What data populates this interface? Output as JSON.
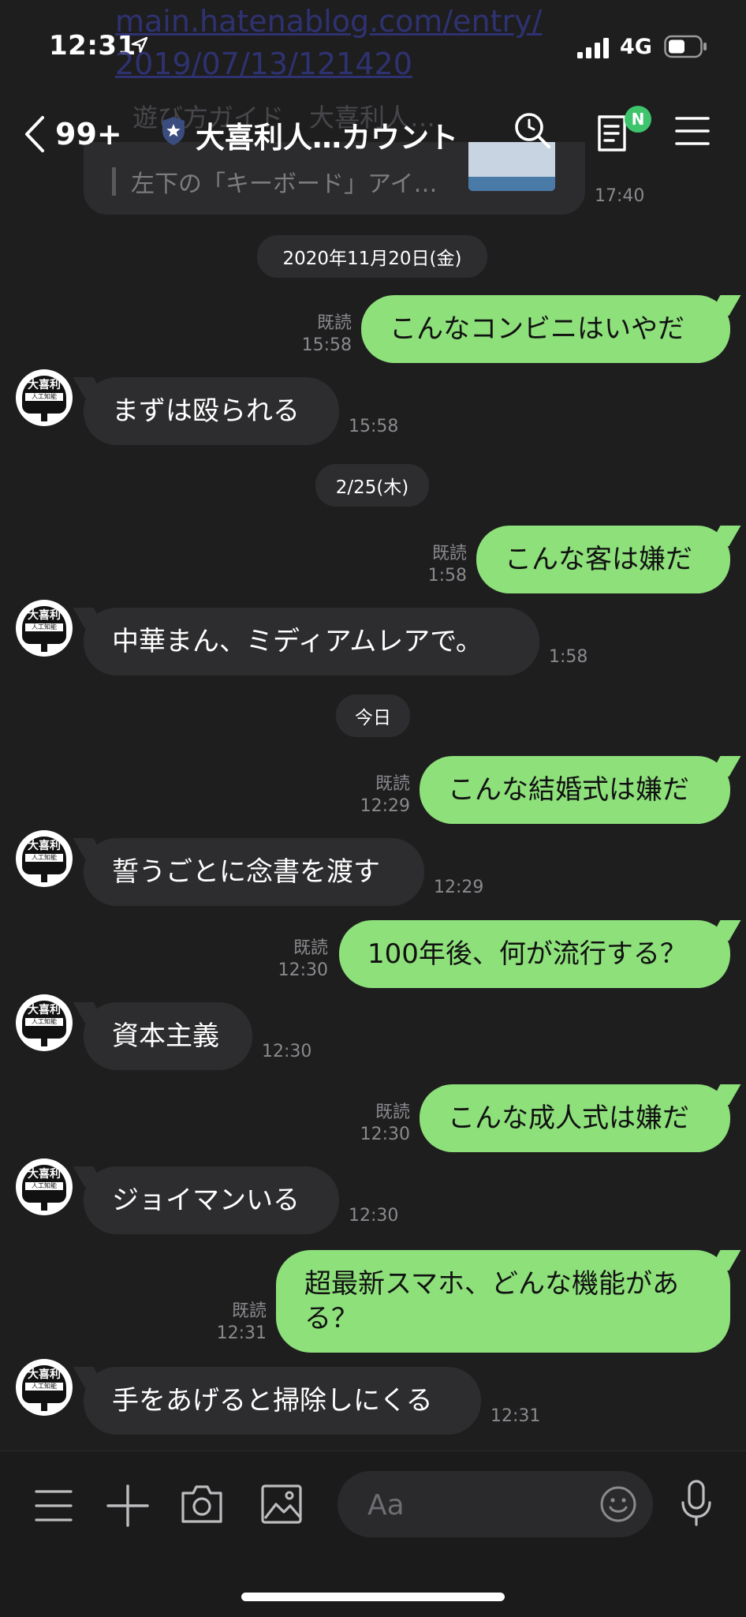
{
  "status_bar": {
    "time": "12:31",
    "network": "4G"
  },
  "background_url": [
    "main.hatenablog.com/entry/",
    "2019/07/13/121420"
  ],
  "header": {
    "back_count": "99+",
    "title": "大喜利人…カウント",
    "badge": "N"
  },
  "previous_preview": {
    "title": "遊び方ガイド　大喜利人…",
    "text": "左下の「キーボード」アイ…",
    "time": "17:40"
  },
  "dates": {
    "d1": "2020年11月20日(金)",
    "d2": "2/25(木)",
    "d3": "今日"
  },
  "messages": [
    {
      "from": "me",
      "text": "こんなコンビニはいやだ",
      "read": "既読",
      "time": "15:58"
    },
    {
      "from": "bot",
      "text": "まずは殴られる",
      "time": "15:58"
    },
    {
      "from": "me",
      "text": "こんな客は嫌だ",
      "read": "既読",
      "time": "1:58"
    },
    {
      "from": "bot",
      "text": "中華まん、ミディアムレアで。",
      "time": "1:58"
    },
    {
      "from": "me",
      "text": "こんな結婚式は嫌だ",
      "read": "既読",
      "time": "12:29"
    },
    {
      "from": "bot",
      "text": "誓うごとに念書を渡す",
      "time": "12:29"
    },
    {
      "from": "me",
      "text": "100年後、何が流行する？",
      "read": "既読",
      "time": "12:30"
    },
    {
      "from": "bot",
      "text": "資本主義",
      "time": "12:30"
    },
    {
      "from": "me",
      "text": "こんな成人式は嫌だ",
      "read": "既読",
      "time": "12:30"
    },
    {
      "from": "bot",
      "text": "ジョイマンいる",
      "time": "12:30"
    },
    {
      "from": "me",
      "text_line1": "超最新スマホ、どんな機能があ",
      "text_line2": "る？",
      "read": "既読",
      "time": "12:31"
    },
    {
      "from": "bot",
      "text": "手をあげると掃除しにくる",
      "time": "12:31"
    }
  ],
  "avatar": {
    "label": "大喜利",
    "sub": "人工知能"
  },
  "input": {
    "placeholder": "Aa"
  },
  "colors": {
    "my_bubble": "#8de07a",
    "bot_bubble": "#2d2d2f",
    "background": "#1e1e1f",
    "badge": "#3ec46d"
  }
}
